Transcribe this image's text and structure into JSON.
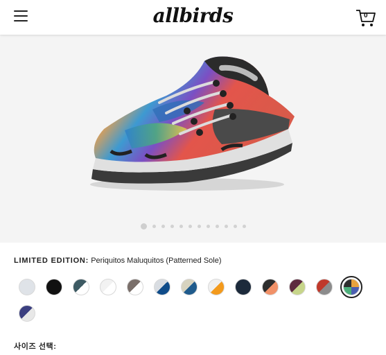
{
  "header": {
    "logo": "allbirds",
    "cart_count": "0"
  },
  "gallery": {
    "image_alt": "Periquitos Maluquitos sneaker",
    "dot_count": 12,
    "active_index": 0
  },
  "product": {
    "edition_label": "LIMITED EDITION:",
    "edition_name": "Periquitos Maluquitos (Patterned Sole)"
  },
  "swatches": [
    {
      "top": "#dfe3e8",
      "bottom": "#dfe3e8"
    },
    {
      "top": "#111111",
      "bottom": "#111111"
    },
    {
      "top": "#3d5a63",
      "bottom": "#ffffff"
    },
    {
      "top": "#f2f2f2",
      "bottom": "#ffffff"
    },
    {
      "top": "#7a6f6a",
      "bottom": "#ffffff"
    },
    {
      "top": "#d9dde2",
      "bottom": "#0f4c8a"
    },
    {
      "top": "#d7d3bf",
      "bottom": "#1f5b8c"
    },
    {
      "top": "#f0f0f0",
      "bottom": "#f39a1c"
    },
    {
      "top": "#1c2a3b",
      "bottom": "#1c2a3b"
    },
    {
      "top": "#2d2d2d",
      "bottom": "#f19168"
    },
    {
      "top": "#5d2a3e",
      "bottom": "#c7d58a"
    },
    {
      "top": "#c0392b",
      "bottom": "#8c8c8c"
    },
    {
      "top": "#e6a23c",
      "bottom": "#4a5eb0",
      "multi": true
    },
    {
      "top": "#3b3f80",
      "bottom": "#e8e8e8"
    }
  ],
  "selected_swatch": 12,
  "size_select_label": "사이즈 선택:"
}
